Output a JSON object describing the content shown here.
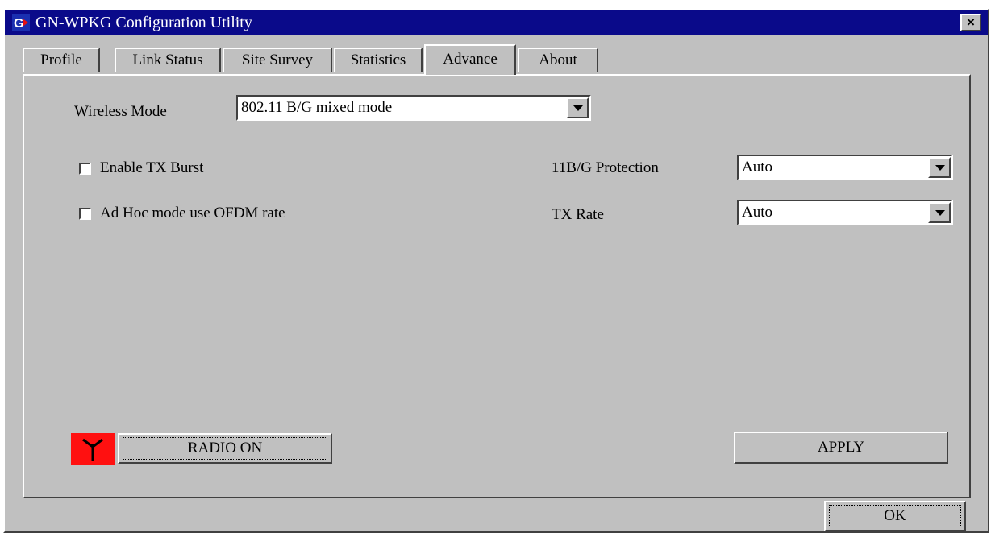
{
  "window": {
    "title": "GN-WPKG Configuration Utility",
    "close_glyph": "×"
  },
  "tabs": [
    {
      "label": "Profile"
    },
    {
      "label": "Link Status"
    },
    {
      "label": "Site Survey"
    },
    {
      "label": "Statistics"
    },
    {
      "label": "Advance",
      "active": true
    },
    {
      "label": "About"
    }
  ],
  "advance": {
    "wireless_mode_label": "Wireless Mode",
    "wireless_mode_value": "802.11 B/G mixed mode",
    "enable_tx_burst_label": "Enable TX Burst",
    "enable_tx_burst_checked": false,
    "adhoc_ofdm_label": "Ad Hoc mode use OFDM rate",
    "adhoc_ofdm_checked": false,
    "protection_label": "11B/G Protection",
    "protection_value": "Auto",
    "tx_rate_label": "TX Rate",
    "tx_rate_value": "Auto",
    "radio_button_label": "RADIO ON",
    "apply_button_label": "APPLY"
  },
  "footer": {
    "ok_button_label": "OK"
  },
  "colors": {
    "titlebar": "#0a0a8a",
    "face": "#c0c0c0",
    "radio_indicator": "#ff1010"
  },
  "icons": {
    "app": "app-logo-icon",
    "radio": "antenna-icon",
    "dropdown": "dropdown-arrow-icon"
  }
}
